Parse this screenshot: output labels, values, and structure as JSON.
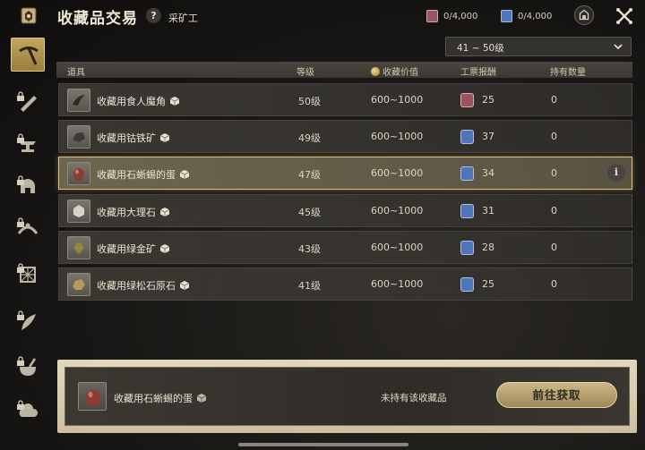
{
  "header": {
    "title": "收藏品交易",
    "help_label": "?",
    "subtitle": "采矿工",
    "ticket_red": {
      "count": "0/4,000",
      "color": "#9b5560"
    },
    "ticket_blue": {
      "count": "0/4,000",
      "color": "#4e76b8"
    }
  },
  "sidebar": {
    "items": [
      {
        "icon": "pickaxe-icon",
        "active": true,
        "locked": false
      },
      {
        "icon": "saw-icon",
        "active": false,
        "locked": true
      },
      {
        "icon": "anvil-icon",
        "active": false,
        "locked": true
      },
      {
        "icon": "helmet-icon",
        "active": false,
        "locked": true
      },
      {
        "icon": "tiara-icon",
        "active": false,
        "locked": true
      },
      {
        "icon": "web-icon",
        "active": false,
        "locked": true
      },
      {
        "icon": "feather-icon",
        "active": false,
        "locked": true
      },
      {
        "icon": "mortar-icon",
        "active": false,
        "locked": true
      },
      {
        "icon": "cloud-icon",
        "active": false,
        "locked": true
      }
    ]
  },
  "filter": {
    "level_range": "41 ~ 50级"
  },
  "table": {
    "headers": {
      "item": "道具",
      "level": "等级",
      "value": "收藏价值",
      "reward": "工票报酬",
      "owned": "持有数量"
    },
    "rows": [
      {
        "name": "收藏用食人魔角",
        "level": "50级",
        "value": "600~1000",
        "reward": "25",
        "reward_type": "red",
        "owned": "0",
        "selected": false
      },
      {
        "name": "收藏用钴铁矿",
        "level": "49级",
        "value": "600~1000",
        "reward": "37",
        "reward_type": "blue",
        "owned": "0",
        "selected": false
      },
      {
        "name": "收藏用石蜥蜴的蛋",
        "level": "47级",
        "value": "600~1000",
        "reward": "34",
        "reward_type": "blue",
        "owned": "0",
        "selected": true
      },
      {
        "name": "收藏用大理石",
        "level": "45级",
        "value": "600~1000",
        "reward": "31",
        "reward_type": "blue",
        "owned": "0",
        "selected": false
      },
      {
        "name": "收藏用绿金矿",
        "level": "43级",
        "value": "600~1000",
        "reward": "28",
        "reward_type": "blue",
        "owned": "0",
        "selected": false
      },
      {
        "name": "收藏用绿松石原石",
        "level": "41级",
        "value": "600~1000",
        "reward": "25",
        "reward_type": "blue",
        "owned": "0",
        "selected": false
      }
    ],
    "info_label": "i"
  },
  "detail": {
    "name": "收藏用石蜥蜴的蛋",
    "status": "未持有该收藏品",
    "action": "前往获取"
  },
  "colors": {
    "accent_gold": "#d9c27e",
    "red_ticket": "#9b5560",
    "blue_ticket": "#4e76b8"
  }
}
